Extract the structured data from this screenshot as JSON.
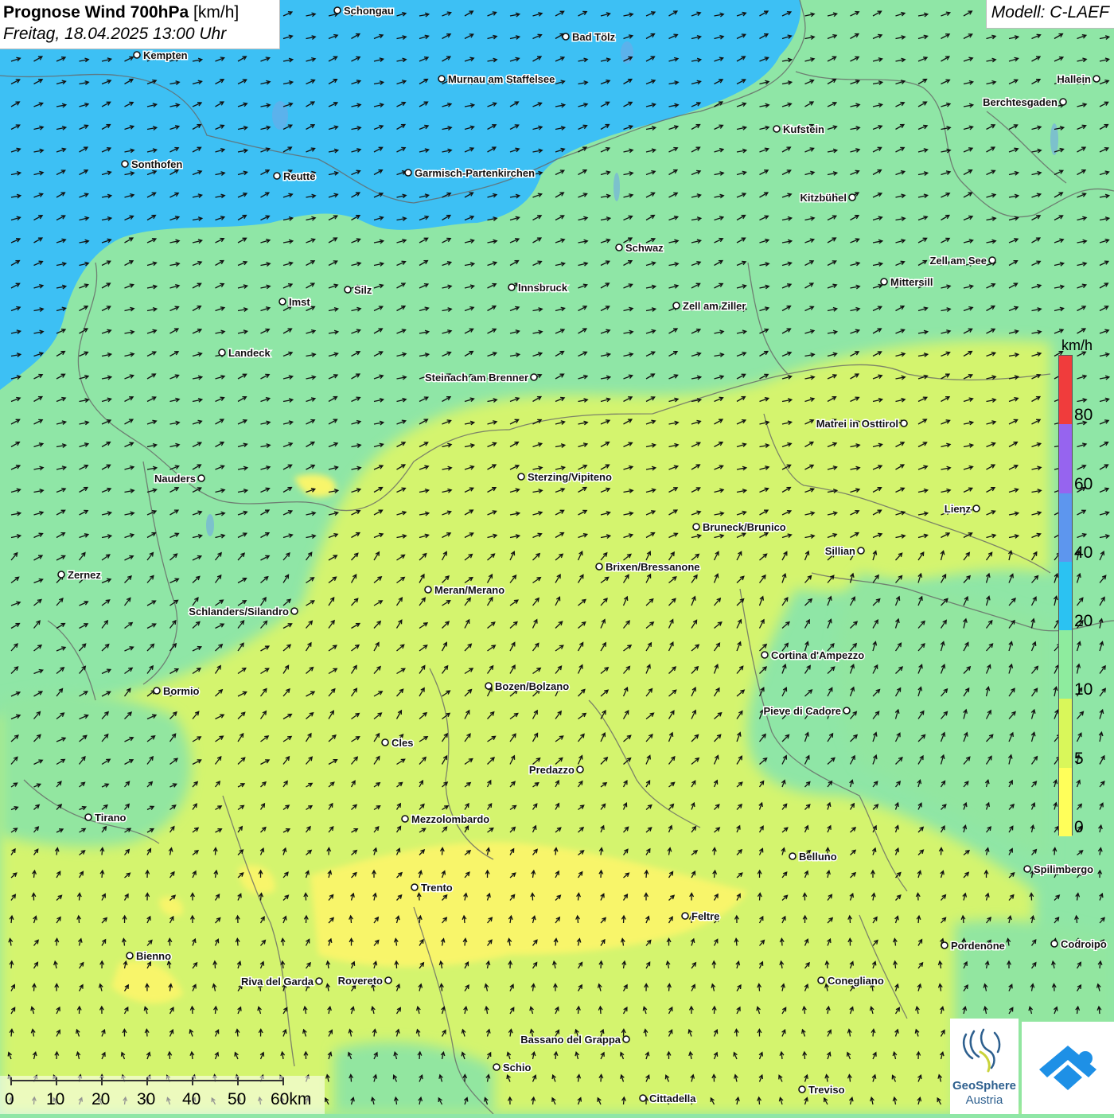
{
  "header": {
    "title_bold": "Prognose Wind 700hPa",
    "title_unit": "[km/h]",
    "subtitle": "Freitag, 18.04.2025 13:00 Uhr"
  },
  "model": {
    "label": "Modell: C-LAEF"
  },
  "legend": {
    "unit": "km/h",
    "bands": [
      {
        "label": "0",
        "color": "#ffff5a"
      },
      {
        "label": "5",
        "color": "#d9f75a"
      },
      {
        "label": "10",
        "color": "#8eec9e"
      },
      {
        "label": "20",
        "color": "#2bc2f2"
      },
      {
        "label": "40",
        "color": "#5d96ee"
      },
      {
        "label": "60",
        "color": "#9664ef"
      },
      {
        "label": "80",
        "color": "#f03c3c"
      }
    ]
  },
  "cities": [
    {
      "name": "Schongau",
      "side": "right"
    },
    {
      "name": "Bad Tölz",
      "side": "right"
    },
    {
      "name": "Kempten",
      "side": "right"
    },
    {
      "name": "Murnau am Staffelsee",
      "side": "right"
    },
    {
      "name": "Hallein",
      "side": "left"
    },
    {
      "name": "Berchtesgaden",
      "side": "left"
    },
    {
      "name": "Kufstein",
      "side": "right"
    },
    {
      "name": "Sonthofen",
      "side": "right"
    },
    {
      "name": "Reutte",
      "side": "right"
    },
    {
      "name": "Garmisch-Partenkirchen",
      "side": "right"
    },
    {
      "name": "Kitzbühel",
      "side": "left"
    },
    {
      "name": "Schwaz",
      "side": "right"
    },
    {
      "name": "Zell am See",
      "side": "left"
    },
    {
      "name": "Mittersill",
      "side": "right"
    },
    {
      "name": "Innsbruck",
      "side": "right"
    },
    {
      "name": "Silz",
      "side": "right"
    },
    {
      "name": "Imst",
      "side": "right"
    },
    {
      "name": "Zell am Ziller",
      "side": "right"
    },
    {
      "name": "Landeck",
      "side": "right"
    },
    {
      "name": "Steinach am Brenner",
      "side": "left"
    },
    {
      "name": "Matrei in Osttirol",
      "side": "left"
    },
    {
      "name": "Nauders",
      "side": "left"
    },
    {
      "name": "Sterzing/Vipiteno",
      "side": "right"
    },
    {
      "name": "Lienz",
      "side": "left"
    },
    {
      "name": "Bruneck/Brunico",
      "side": "right"
    },
    {
      "name": "Sillian",
      "side": "left"
    },
    {
      "name": "Zernez",
      "side": "right"
    },
    {
      "name": "Brixen/Bressanone",
      "side": "right"
    },
    {
      "name": "Meran/Merano",
      "side": "right"
    },
    {
      "name": "Schlanders/Silandro",
      "side": "left"
    },
    {
      "name": "Cortina d'Ampezzo",
      "side": "right"
    },
    {
      "name": "Bozen/Bolzano",
      "side": "right"
    },
    {
      "name": "Bormio",
      "side": "right"
    },
    {
      "name": "Pieve di Cadore",
      "side": "left"
    },
    {
      "name": "Cles",
      "side": "right"
    },
    {
      "name": "Predazzo",
      "side": "left"
    },
    {
      "name": "Tirano",
      "side": "right"
    },
    {
      "name": "Mezzolombardo",
      "side": "right"
    },
    {
      "name": "Belluno",
      "side": "right"
    },
    {
      "name": "Spilimbergo",
      "side": "right"
    },
    {
      "name": "Trento",
      "side": "right"
    },
    {
      "name": "Feltre",
      "side": "right"
    },
    {
      "name": "Pordenone",
      "side": "right"
    },
    {
      "name": "Codroipo",
      "side": "right"
    },
    {
      "name": "Bienno",
      "side": "right"
    },
    {
      "name": "Riva del Garda",
      "side": "left"
    },
    {
      "name": "Rovereto",
      "side": "left"
    },
    {
      "name": "Conegliano",
      "side": "right"
    },
    {
      "name": "Bassano del Grappa",
      "side": "left"
    },
    {
      "name": "Schio",
      "side": "right"
    },
    {
      "name": "Treviso",
      "side": "right"
    },
    {
      "name": "Cittadella",
      "side": "right"
    }
  ],
  "scale": {
    "labels": [
      "0",
      "10",
      "20",
      "30",
      "40",
      "50",
      "60km"
    ]
  },
  "logo": {
    "line1": "GeoSphere",
    "line2": "Austria"
  }
}
